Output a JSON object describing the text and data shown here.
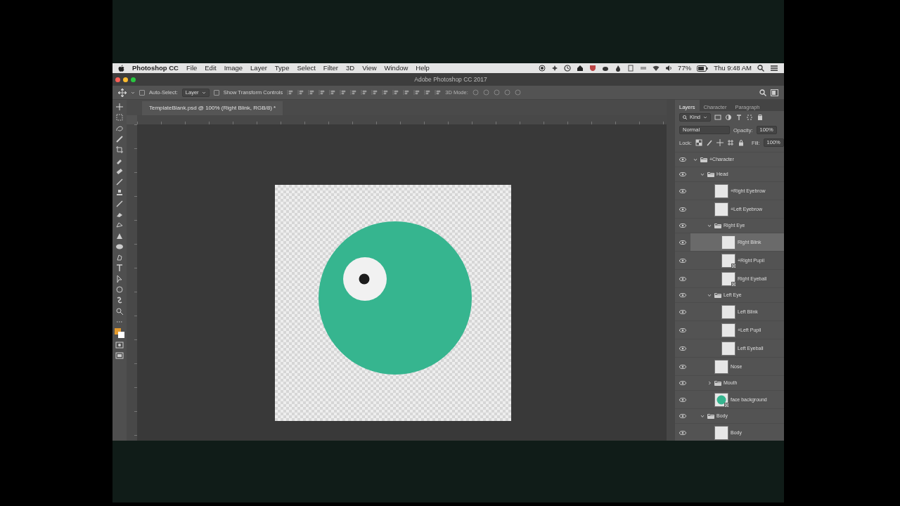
{
  "menu_bar": {
    "app_name": "Photoshop CC",
    "menus": [
      "File",
      "Edit",
      "Image",
      "Layer",
      "Type",
      "Select",
      "Filter",
      "3D",
      "View",
      "Window",
      "Help"
    ],
    "battery": "77%",
    "clock": "Thu 9:48 AM"
  },
  "window": {
    "title": "Adobe Photoshop CC 2017"
  },
  "options_bar": {
    "auto_select_checked": false,
    "auto_select_label": "Auto-Select:",
    "auto_select_value": "Layer",
    "show_transform_controls": {
      "label": "Show Transform Controls",
      "checked": false
    },
    "mode_label": "3D Mode:"
  },
  "document_tab": {
    "title": "TemplateBlank.psd @ 100% (Right Blink, RGB/8) *"
  },
  "panel": {
    "tabs": [
      {
        "label": "Layers",
        "selected": true
      },
      {
        "label": "Character",
        "selected": false
      },
      {
        "label": "Paragraph",
        "selected": false
      }
    ],
    "filter": "Kind",
    "blend_mode": "Normal",
    "opacity_label": "Opacity:",
    "opacity": "100%",
    "lock_label": "Lock:",
    "fill_label": "Fill:",
    "fill": "100%",
    "layers": [
      {
        "name": "+Character",
        "kind": "group",
        "expanded": true,
        "visible": true,
        "selected": false,
        "children": [
          {
            "name": "Head",
            "kind": "group",
            "expanded": true,
            "visible": true,
            "selected": false,
            "children": [
              {
                "name": "+Right Eyebrow",
                "kind": "layer",
                "smart_object": false,
                "visible": true,
                "selected": false
              },
              {
                "name": "+Left Eyebrow",
                "kind": "layer",
                "smart_object": false,
                "visible": true,
                "selected": false
              },
              {
                "name": "Right Eye",
                "kind": "group",
                "expanded": true,
                "visible": true,
                "selected": false,
                "children": [
                  {
                    "name": "Right Blink",
                    "kind": "layer",
                    "smart_object": false,
                    "visible": true,
                    "selected": true
                  },
                  {
                    "name": "+Right Pupil",
                    "kind": "layer",
                    "smart_object": true,
                    "visible": true,
                    "selected": false
                  },
                  {
                    "name": "Right Eyeball",
                    "kind": "layer",
                    "smart_object": true,
                    "visible": true,
                    "selected": false
                  }
                ]
              },
              {
                "name": "Left Eye",
                "kind": "group",
                "expanded": true,
                "visible": true,
                "selected": false,
                "children": [
                  {
                    "name": "Left Blink",
                    "kind": "layer",
                    "smart_object": false,
                    "visible": true,
                    "selected": false
                  },
                  {
                    "name": "+Left Pupil",
                    "kind": "layer",
                    "smart_object": false,
                    "visible": true,
                    "selected": false
                  },
                  {
                    "name": "Left Eyeball",
                    "kind": "layer",
                    "smart_object": false,
                    "visible": true,
                    "selected": false
                  }
                ]
              },
              {
                "name": "Nose",
                "kind": "layer",
                "smart_object": false,
                "visible": true,
                "selected": false
              },
              {
                "name": "Mouth",
                "kind": "group",
                "expanded": false,
                "visible": true,
                "selected": false
              },
              {
                "name": "face background",
                "kind": "image",
                "smart_object": true,
                "visible": true,
                "selected": false
              }
            ]
          },
          {
            "name": "Body",
            "kind": "group",
            "expanded": true,
            "visible": true,
            "selected": false,
            "children": [
              {
                "name": "Body",
                "kind": "layer",
                "smart_object": false,
                "visible": true,
                "selected": false
              }
            ]
          }
        ]
      }
    ]
  }
}
